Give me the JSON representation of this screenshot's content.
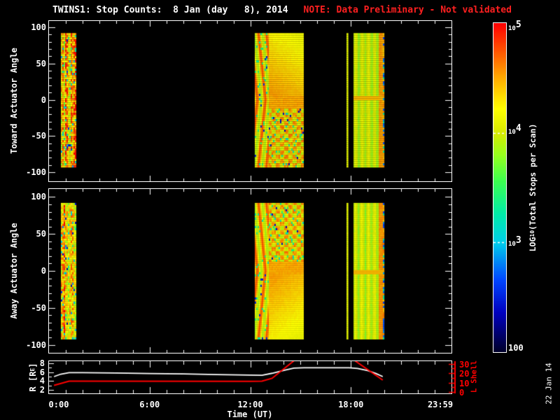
{
  "title": {
    "main": "TWINS1: Stop Counts:  8 Jan (day   8), 2014",
    "note": "NOTE: Data Preliminary - Not validated"
  },
  "datestamp": "22 Jan 14",
  "colors": {
    "background": "#000000",
    "foreground": "#ffffff",
    "note_red": "#ff2020",
    "lshell_red": "#ff0000"
  },
  "chart_data": [
    {
      "type": "heatmap",
      "ylabel": "Toward Actuator Angle",
      "orientation": "toward",
      "yticks": [
        100,
        50,
        0,
        -50,
        -100
      ],
      "y_minor_step": 10,
      "yrange": [
        -110,
        110
      ],
      "xrange_hours": [
        0,
        24
      ],
      "bands": [
        {
          "start_hour": 0.71,
          "end_hour": 1.59,
          "angle_min": -92,
          "angle_max": 92,
          "style": "mottled"
        },
        {
          "start_hour": 12.27,
          "end_hour": 15.11,
          "angle_min": -92,
          "angle_max": 92,
          "style": "structured"
        },
        {
          "start_hour": 17.74,
          "end_hour": 17.85,
          "angle_min": -92,
          "angle_max": 92,
          "style": "solid"
        },
        {
          "start_hour": 18.16,
          "end_hour": 19.95,
          "angle_min": -92,
          "angle_max": 92,
          "style": "striped"
        }
      ]
    },
    {
      "type": "heatmap",
      "ylabel": "Away Actuator Angle",
      "orientation": "away",
      "yticks": [
        100,
        50,
        0,
        -50,
        -100
      ],
      "y_minor_step": 10,
      "yrange": [
        -110,
        110
      ],
      "xrange_hours": [
        0,
        24
      ],
      "bands": [
        {
          "start_hour": 0.71,
          "end_hour": 1.59,
          "angle_min": -92,
          "angle_max": 92,
          "style": "mottled"
        },
        {
          "start_hour": 12.27,
          "end_hour": 15.11,
          "angle_min": -92,
          "angle_max": 92,
          "style": "structured"
        },
        {
          "start_hour": 17.74,
          "end_hour": 17.85,
          "angle_min": -92,
          "angle_max": 92,
          "style": "solid"
        },
        {
          "start_hour": 18.16,
          "end_hour": 19.95,
          "angle_min": -92,
          "angle_max": 92,
          "style": "striped"
        }
      ]
    },
    {
      "type": "line",
      "x_axis": {
        "label": "Time (UT)",
        "tick_labels": [
          "0:00",
          "6:00",
          "12:00",
          "18:00",
          "23:59"
        ],
        "tick_hours": [
          0,
          6,
          12,
          18,
          23.983
        ],
        "minor_step_hours": 1
      },
      "left_axis": {
        "label": "R [RE]",
        "label_parts": {
          "pre": "R [R",
          "sub": "E",
          "post": "]"
        },
        "ticks": [
          8,
          6,
          4,
          2
        ],
        "range": [
          1.45,
          8.45
        ]
      },
      "right_axis": {
        "label": "L Shell",
        "ticks": [
          30,
          20,
          10,
          0
        ],
        "range": [
          -1.5,
          32.5
        ]
      },
      "series": [
        {
          "name": "R [RE]",
          "color": "#ffffff",
          "axis": "left",
          "points": [
            [
              0.3,
              5.0
            ],
            [
              0.7,
              5.55
            ],
            [
              1.2,
              5.9
            ],
            [
              2,
              5.9
            ],
            [
              4,
              5.8
            ],
            [
              6,
              5.7
            ],
            [
              8,
              5.6
            ],
            [
              10,
              5.45
            ],
            [
              12,
              5.35
            ],
            [
              12.7,
              5.3
            ],
            [
              13.3,
              5.75
            ],
            [
              14,
              6.4
            ],
            [
              14.6,
              6.9
            ],
            [
              15.2,
              7.0
            ],
            [
              17.9,
              7.0
            ],
            [
              18.4,
              6.85
            ],
            [
              19,
              6.35
            ],
            [
              19.5,
              5.7
            ],
            [
              19.9,
              5.0
            ]
          ]
        },
        {
          "name": "L Shell",
          "color": "#ff0000",
          "axis": "right",
          "segments": [
            [
              [
                0.3,
                7.0
              ],
              [
                1.2,
                11.5
              ],
              [
                2,
                11.4
              ],
              [
                12,
                11.3
              ],
              [
                12.7,
                11.5
              ],
              [
                13.3,
                14.5
              ],
              [
                14.6,
                33.0
              ]
            ],
            [
              [
                18.25,
                33.0
              ],
              [
                19.9,
                12.6
              ]
            ]
          ]
        }
      ]
    },
    {
      "type": "colorbar",
      "label": "LOG10(Total Stops per Scan)",
      "label_parts": {
        "pre": "LOG",
        "sub": "10",
        "post": "(Total Stops per Scan)"
      },
      "tick_labels": [
        "10^5",
        "10^4",
        "10^3",
        "100"
      ],
      "tick_log_values": [
        5,
        4,
        3,
        2
      ],
      "range_log": [
        2,
        5
      ],
      "colormap": "rainbow"
    }
  ]
}
